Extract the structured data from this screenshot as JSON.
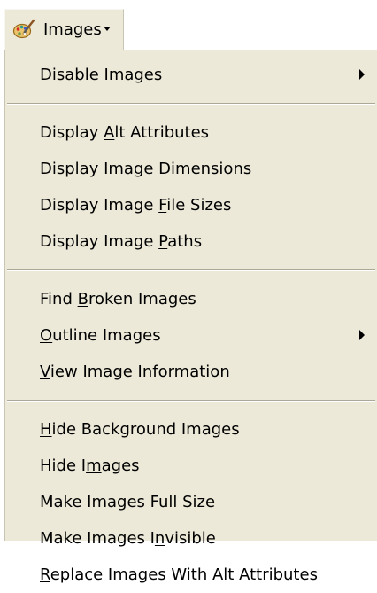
{
  "toolbar": {
    "images_label": "Images",
    "icon": "paint-palette-brush-icon"
  },
  "menu": {
    "groups": [
      [
        {
          "pre": "",
          "key": "D",
          "post": "isable Images",
          "submenu": true
        }
      ],
      [
        {
          "pre": "Display ",
          "key": "A",
          "post": "lt Attributes",
          "submenu": false
        },
        {
          "pre": "Display ",
          "key": "I",
          "post": "mage Dimensions",
          "submenu": false
        },
        {
          "pre": "Display Image ",
          "key": "F",
          "post": "ile Sizes",
          "submenu": false
        },
        {
          "pre": "Display Image ",
          "key": "P",
          "post": "aths",
          "submenu": false
        }
      ],
      [
        {
          "pre": "Find ",
          "key": "B",
          "post": "roken Images",
          "submenu": false
        },
        {
          "pre": "",
          "key": "O",
          "post": "utline Images",
          "submenu": true
        },
        {
          "pre": "",
          "key": "V",
          "post": "iew Image Information",
          "submenu": false
        }
      ],
      [
        {
          "pre": "",
          "key": "H",
          "post": "ide Background Images",
          "submenu": false
        },
        {
          "pre": "Hide I",
          "key": "m",
          "post": "ages",
          "submenu": false
        },
        {
          "pre": "Make Images Full Size",
          "key": "",
          "post": "",
          "submenu": false
        },
        {
          "pre": "Make Images I",
          "key": "n",
          "post": "visible",
          "submenu": false
        },
        {
          "pre": "",
          "key": "R",
          "post": "eplace Images With Alt Attributes",
          "submenu": false
        }
      ]
    ]
  },
  "colors": {
    "menu_background": "#ece9d8",
    "separator_dark": "#aca899",
    "separator_light": "#ffffff",
    "text": "#000000"
  }
}
